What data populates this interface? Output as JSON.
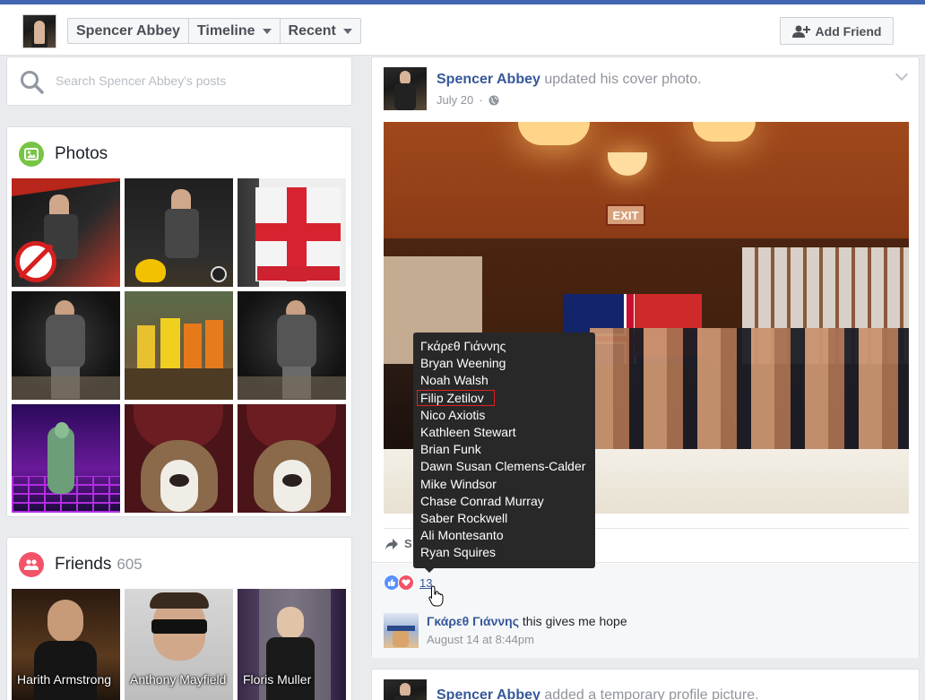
{
  "header": {
    "nav": [
      {
        "label": "Spencer Abbey",
        "caret": false
      },
      {
        "label": "Timeline",
        "caret": true
      },
      {
        "label": "Recent",
        "caret": true
      }
    ],
    "add_friend": "Add Friend"
  },
  "search": {
    "placeholder": "Search Spencer Abbey's posts"
  },
  "photos": {
    "title": "Photos",
    "icon": "photo-icon"
  },
  "friends": {
    "title": "Friends",
    "count": "605",
    "items": [
      {
        "name": "Harith Armstrong"
      },
      {
        "name": "Anthony Mayfield"
      },
      {
        "name": "Floris Muller"
      }
    ]
  },
  "post": {
    "author": "Spencer Abbey",
    "action": " updated his cover photo.",
    "date": "July 20",
    "audience_icon": "globe-icon",
    "share_label": "S",
    "reaction_count": "13",
    "reactions_tooltip": [
      "Γκάρεθ Γιάννης",
      "Bryan Weening",
      "Noah Walsh",
      "Filip Zetilov",
      "Nico Axiotis",
      "Kathleen Stewart",
      "Brian Funk",
      "Dawn Susan Clemens-Calder",
      "Mike Windsor",
      "Chase Conrad Murray",
      "Saber Rockwell",
      "Ali Montesanto",
      "Ryan Squires"
    ],
    "cover_sign": "EXIT",
    "comment": {
      "author": "Γκάρεθ Γιάννης",
      "text": " this gives me hope",
      "time": "August 14 at 8:44pm"
    }
  },
  "post2": {
    "author": "Spencer Abbey",
    "action": " added a temporary profile picture."
  },
  "colors": {
    "brand": "#4267b2",
    "link": "#365899",
    "photos_icon_bg": "#78c445",
    "friends_icon_bg": "#f35369",
    "tooltip_bg": "#282828"
  }
}
